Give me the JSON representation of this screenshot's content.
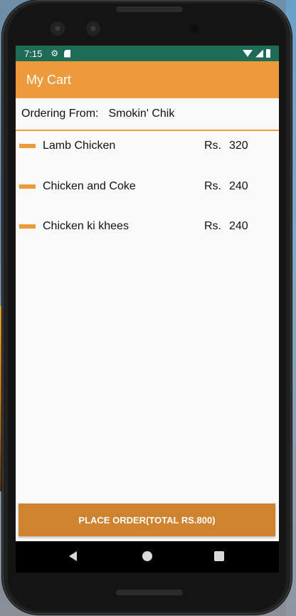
{
  "status_bar": {
    "time": "7:15",
    "icons": [
      "gear-icon",
      "sdcard-icon",
      "wifi-icon",
      "signal-icon",
      "battery-icon"
    ],
    "color": "#1e6b57"
  },
  "app_bar": {
    "title": "My Cart",
    "color": "#ed9a3c"
  },
  "ordering": {
    "label": "Ordering From:",
    "restaurant": "Smokin' Chik"
  },
  "items": [
    {
      "name": "Lamb Chicken",
      "currency": "Rs.",
      "price": "320"
    },
    {
      "name": "Chicken and Coke",
      "currency": "Rs.",
      "price": "240"
    },
    {
      "name": "Chicken ki khees",
      "currency": "Rs.",
      "price": "240"
    }
  ],
  "place_order": {
    "label": "PLACE ORDER(TOTAL RS.800)",
    "color": "#d0832f"
  },
  "nav": {
    "icons": [
      "back-icon",
      "home-icon",
      "recents-icon"
    ]
  }
}
